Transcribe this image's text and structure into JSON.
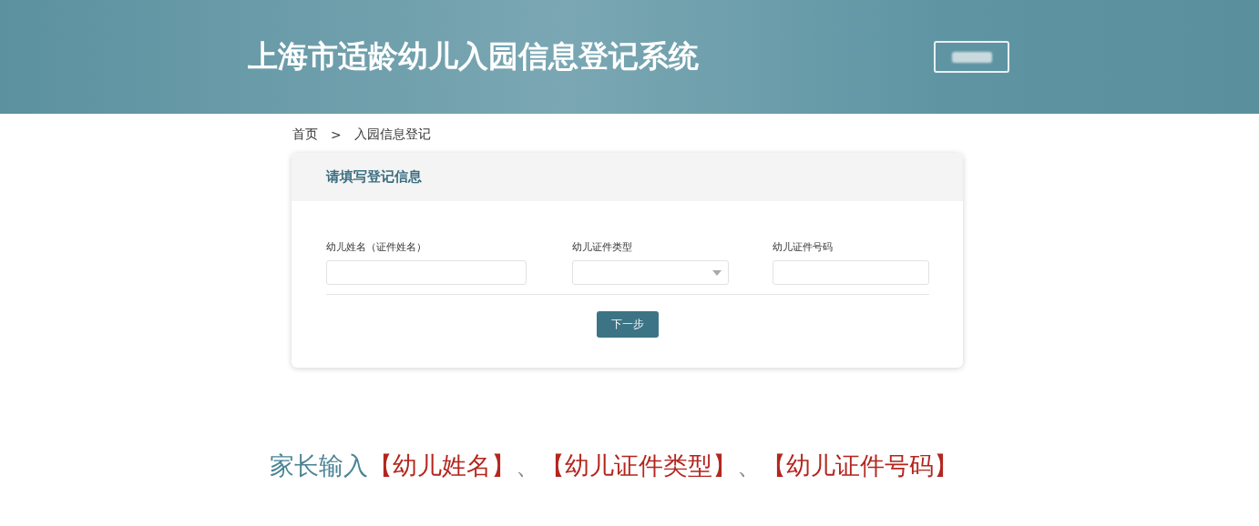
{
  "header": {
    "title": "上海市适龄幼儿入园信息登记系统"
  },
  "breadcrumb": {
    "items": [
      "首页",
      "入园信息登记"
    ],
    "separator": ">"
  },
  "form": {
    "title": "请填写登记信息",
    "fields": [
      {
        "kind": "text",
        "label": "幼儿姓名（证件姓名）"
      },
      {
        "kind": "select",
        "label": "幼儿证件类型"
      },
      {
        "kind": "text",
        "label": "幼儿证件号码"
      }
    ],
    "submit": "下一步"
  },
  "caption": [
    {
      "text": "家长输入",
      "color": "#4a8494"
    },
    {
      "text": "【幼儿姓名】",
      "color": "#b3261e"
    },
    {
      "text": "、",
      "color": "#8a8a8a"
    },
    {
      "text": "【幼儿证件类型】",
      "color": "#b3261e"
    },
    {
      "text": "、",
      "color": "#8a8a8a"
    },
    {
      "text": "【幼儿证件号码】",
      "color": "#b3261e"
    }
  ]
}
